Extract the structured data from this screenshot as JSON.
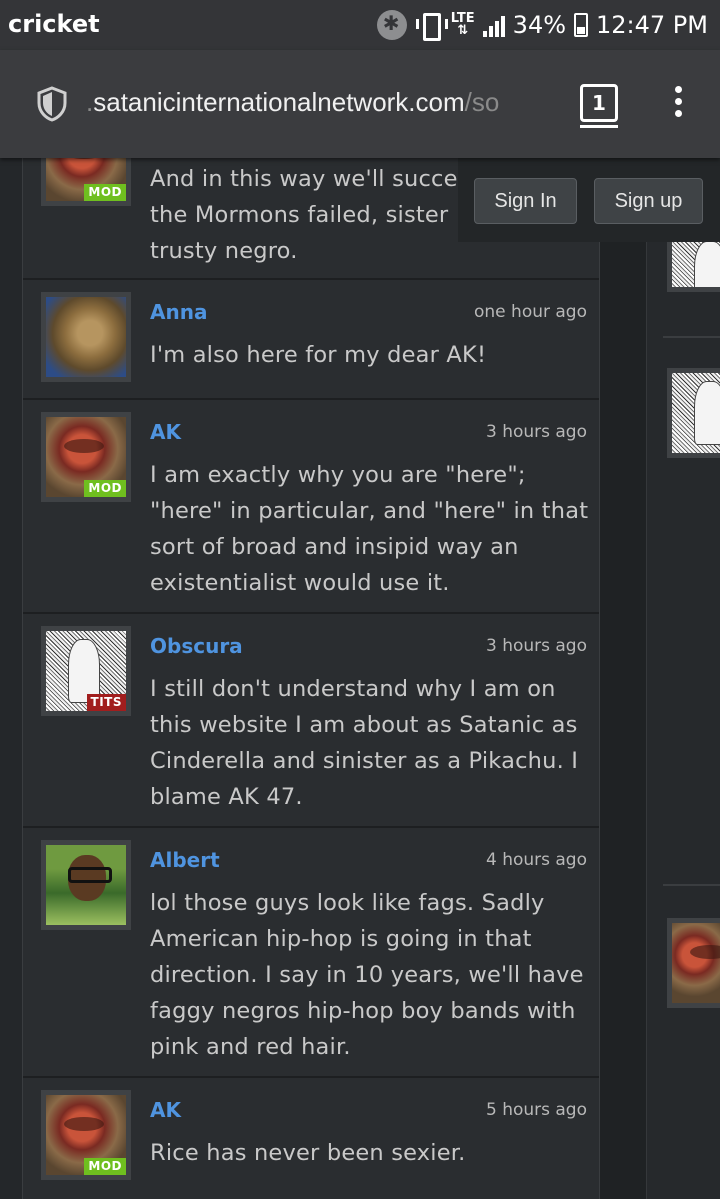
{
  "status_bar": {
    "carrier": "cricket",
    "network": "LTE",
    "battery": "34%",
    "time": "12:47 PM"
  },
  "browser": {
    "url_dim_prefix": ".",
    "url_main": "satanicinternationalnetwork.com",
    "url_dim_suffix": "/so",
    "tab_count": "1"
  },
  "auth": {
    "sign_in": "Sign In",
    "sign_up": "Sign up"
  },
  "comments": [
    {
      "author": "",
      "time": "",
      "badge": "MOD",
      "text": "And in this way we'll succe the Mormons failed, sister trusty negro."
    },
    {
      "author": "Anna",
      "time": "one hour ago",
      "badge": "",
      "text": "I'm also here for my dear AK!"
    },
    {
      "author": "AK",
      "time": "3 hours ago",
      "badge": "MOD",
      "text": "I am exactly why you are \"here\"; \"here\" in particular, and \"here\" in that sort of broad and insipid way an existentialist would use it."
    },
    {
      "author": "Obscura",
      "time": "3 hours ago",
      "badge": "TITS",
      "text": "I still don't understand why I am on this website I am about as Satanic as Cinderella and sinister as a Pikachu. I blame AK 47."
    },
    {
      "author": "Albert",
      "time": "4 hours ago",
      "badge": "",
      "text": "lol those guys look like fags. Sadly American hip-hop is going in that direction. I say in 10 years, we'll have faggy negros hip-hop boy bands with pink and red hair."
    },
    {
      "author": "AK",
      "time": "5 hours ago",
      "badge": "MOD",
      "text": "Rice has never been sexier."
    }
  ]
}
